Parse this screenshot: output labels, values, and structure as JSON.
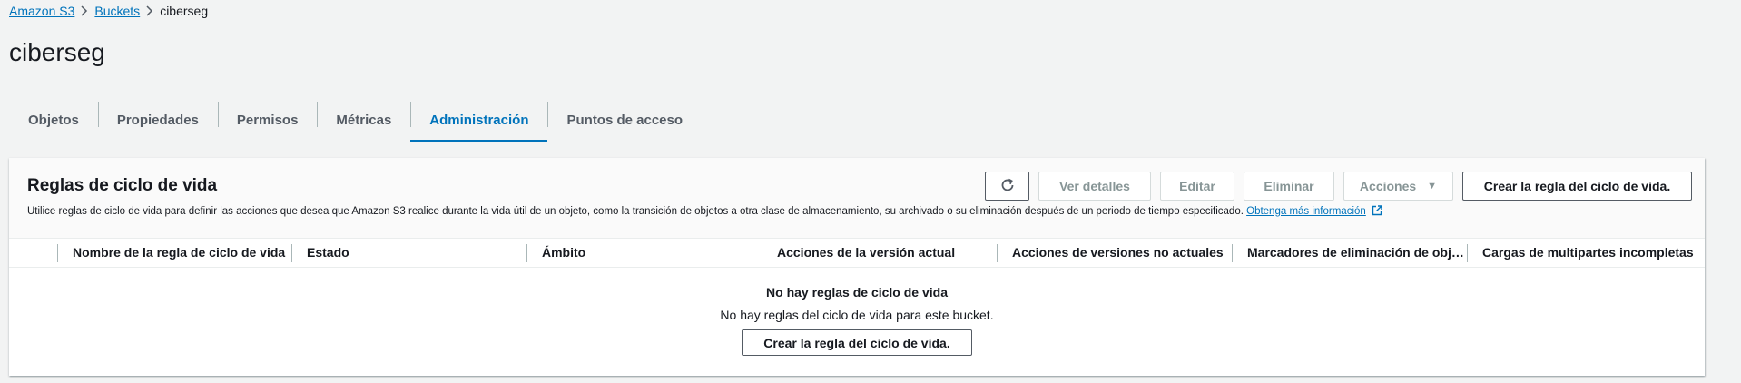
{
  "breadcrumb": {
    "items": [
      "Amazon S3",
      "Buckets"
    ],
    "current": "ciberseg"
  },
  "page": {
    "title": "ciberseg"
  },
  "tabs": [
    "Objetos",
    "Propiedades",
    "Permisos",
    "Métricas",
    "Administración",
    "Puntos de acceso"
  ],
  "active_tab": "Administración",
  "panel": {
    "title": "Reglas de ciclo de vida",
    "description": "Utilice reglas de ciclo de vida para definir las acciones que desea que Amazon S3 realice durante la vida útil de un objeto, como la transición de objetos a otra clase de almacenamiento, su archivado o su eliminación después de un periodo de tiempo especificado.",
    "learn_more": "Obtenga más información",
    "buttons": {
      "refresh_icon": "refresh-icon",
      "view_details": "Ver detalles",
      "edit": "Editar",
      "delete": "Eliminar",
      "actions": "Acciones",
      "create": "Crear la regla del ciclo de vida."
    }
  },
  "table": {
    "columns": [
      "Nombre de la regla de ciclo de vida",
      "Estado",
      "Ámbito",
      "Acciones de la versión actual",
      "Acciones de versiones no actuales",
      "Marcadores de eliminación de objetos caducados",
      "Cargas de multipartes incompletas"
    ],
    "empty": {
      "title": "No hay reglas de ciclo de vida",
      "description": "No hay reglas del ciclo de vida para este bucket.",
      "button": "Crear la regla del ciclo de vida."
    }
  },
  "colors": {
    "link": "#0073bb",
    "text": "#16191f",
    "muted": "#879596",
    "background": "#f2f3f3"
  }
}
